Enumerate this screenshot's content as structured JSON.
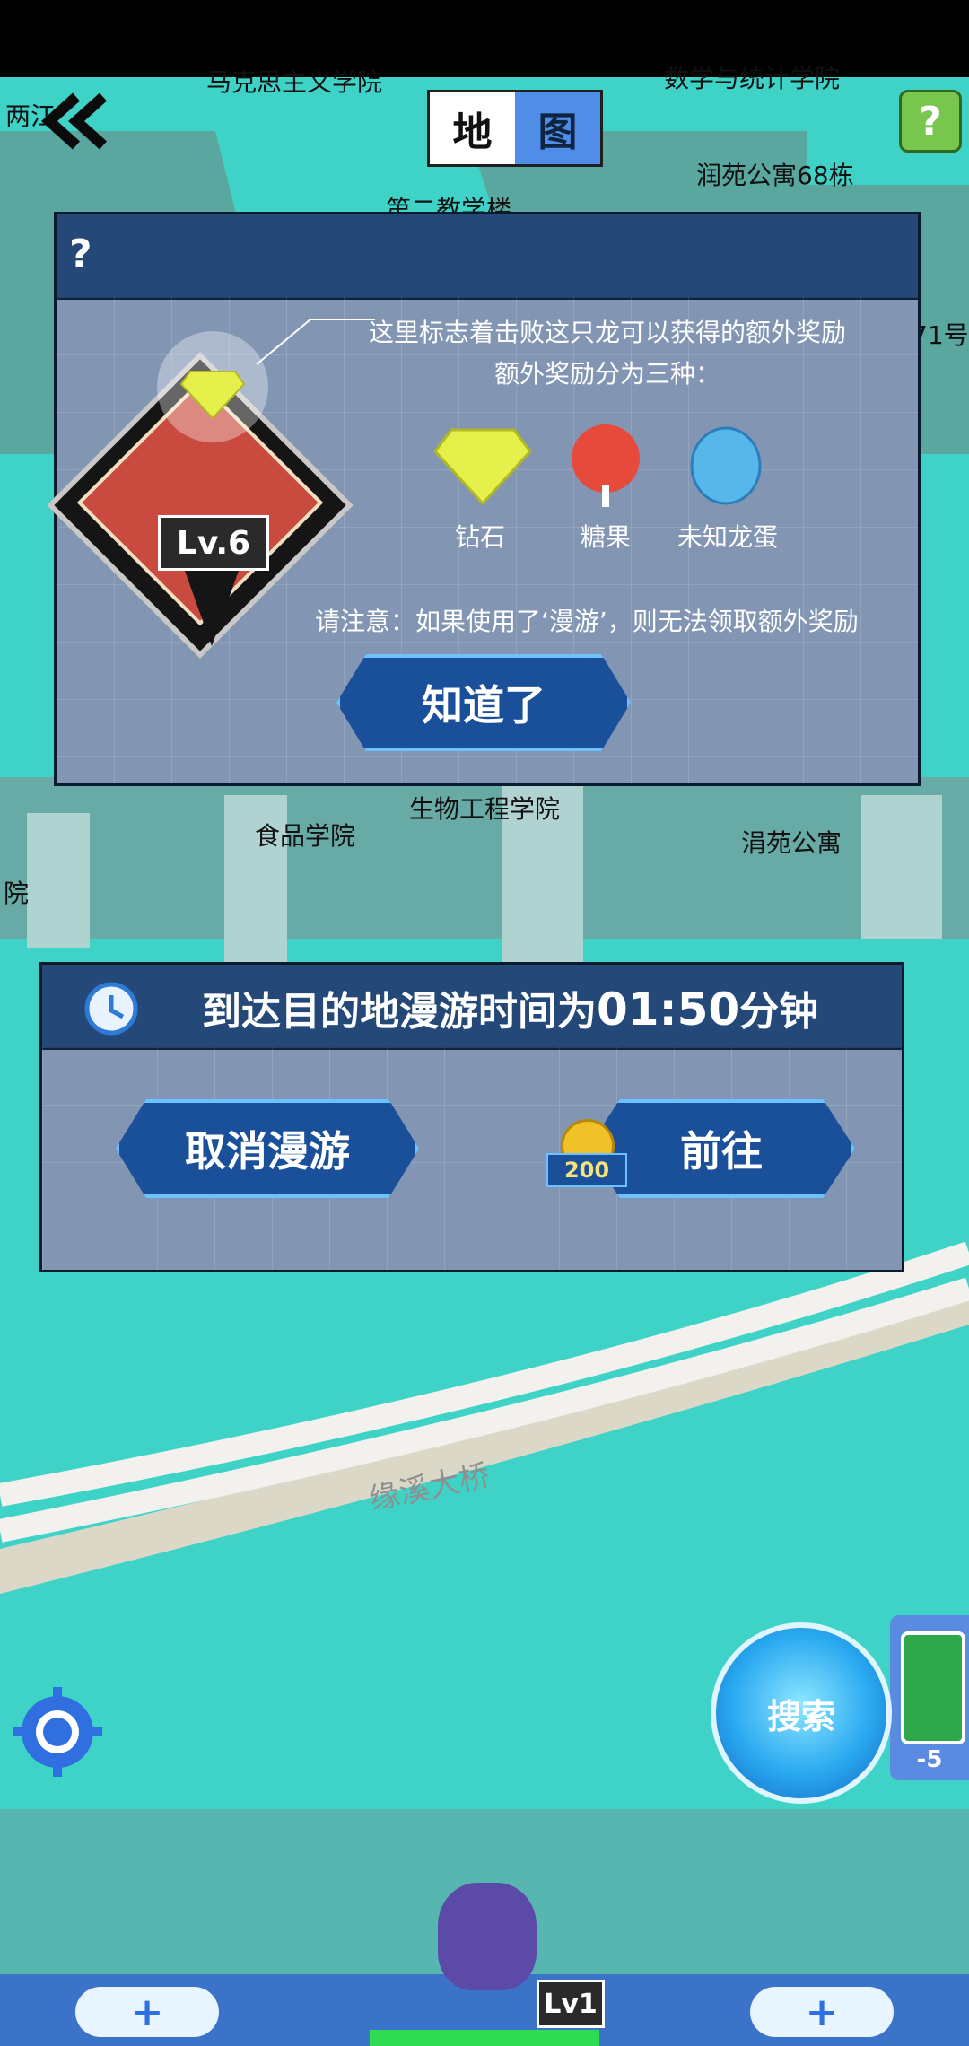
{
  "map": {
    "labels": [
      "两江",
      "马克思主义学院",
      "数学与统计学院",
      "润苑公寓68栋",
      "第二教学楼",
      "71号",
      "生物工程学院",
      "食品学院",
      "涓苑公寓",
      "院",
      "缘溪大桥"
    ]
  },
  "top": {
    "back_icon": "double-chevron-left-icon",
    "title_left": "地",
    "title_right": "图",
    "help_icon": "question-icon"
  },
  "tip_dialog": {
    "help_icon": "question-icon",
    "line1": "这里标志着击败这只龙可以获得的额外奖励",
    "line2": "额外奖励分为三种：",
    "rewards": [
      {
        "label": "钻石",
        "icon": "diamond-icon",
        "color": "#e6f04a"
      },
      {
        "label": "糖果",
        "icon": "candy-icon",
        "color": "#e64a3a"
      },
      {
        "label": "未知龙蛋",
        "icon": "dragon-egg-icon",
        "color": "#57b6ea"
      }
    ],
    "level": "Lv.6",
    "note": "请注意：如果使用了‘漫游’，则无法领取额外奖励",
    "ok_button": "知道了"
  },
  "roam_dialog": {
    "title_prefix": "到达目的地漫游时间为",
    "time": "01:50",
    "title_suffix": "分钟",
    "cancel_button": "取消漫游",
    "go_button": "前往",
    "coin_cost": "200"
  },
  "bottom": {
    "search_button": "搜索",
    "energy_delta": "-5",
    "player_level": "Lv1",
    "slot_left": "+",
    "slot_right": "+"
  },
  "colors": {
    "water": "#3fd3c8",
    "panel_header": "#244878",
    "panel_body": "#8296b4",
    "button_blue": "#1a4f9a"
  }
}
